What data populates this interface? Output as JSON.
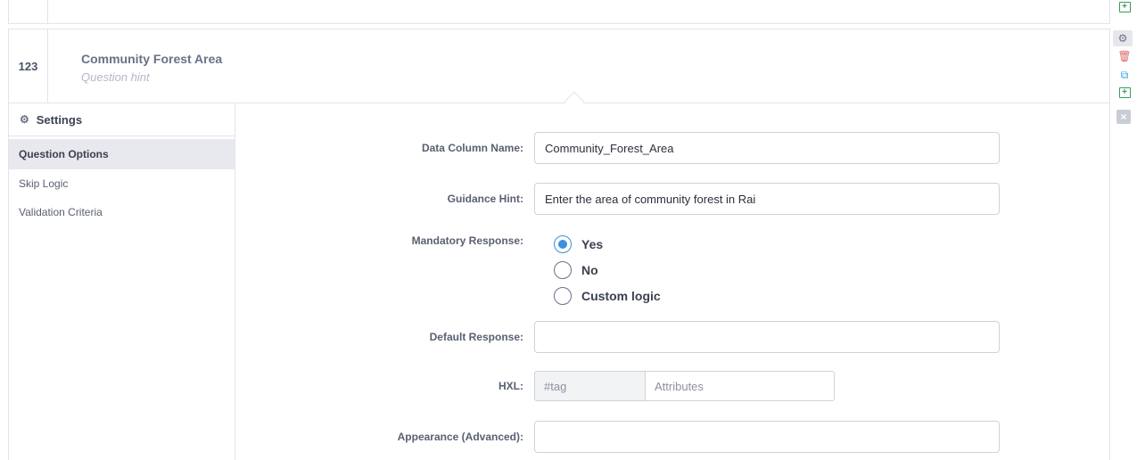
{
  "question": {
    "number": "123",
    "label": "Community Forest Area",
    "hint": "Question hint"
  },
  "row_actions": {
    "settings_icon": "gear-icon",
    "delete_icon": "trash-icon",
    "duplicate_icon": "duplicate-icon",
    "add_icon": "add-question-icon",
    "close_icon": "close-icon",
    "colors": {
      "delete": "#e06a6a",
      "duplicate": "#3a9ce0",
      "add": "#3a9a5a"
    }
  },
  "settings": {
    "title": "Settings",
    "tabs": [
      {
        "label": "Question Options",
        "active": true
      },
      {
        "label": "Skip Logic",
        "active": false
      },
      {
        "label": "Validation Criteria",
        "active": false
      }
    ]
  },
  "form": {
    "data_column_name": {
      "label": "Data Column Name:",
      "value": "Community_Forest_Area"
    },
    "guidance_hint": {
      "label": "Guidance Hint:",
      "value": "Enter the area of community forest in Rai"
    },
    "mandatory": {
      "label": "Mandatory Response:",
      "options": [
        {
          "label": "Yes",
          "checked": true
        },
        {
          "label": "No",
          "checked": false
        },
        {
          "label": "Custom logic",
          "checked": false
        }
      ]
    },
    "default_response": {
      "label": "Default Response:",
      "value": ""
    },
    "hxl": {
      "label": "HXL:",
      "tag_placeholder": "#tag",
      "attributes_placeholder": "Attributes"
    },
    "appearance": {
      "label": "Appearance (Advanced):",
      "value": ""
    }
  },
  "accent_color": "#3a8fe0"
}
